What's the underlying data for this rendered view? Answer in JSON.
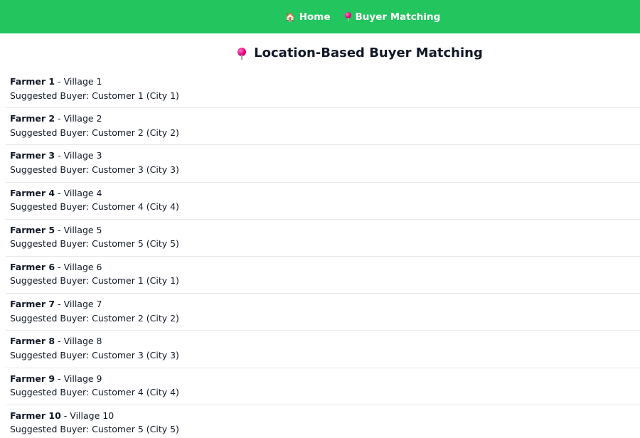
{
  "nav": {
    "home_icon": "🏠",
    "home_label": "Home",
    "buyer_icon": "round-pushpin-icon",
    "buyer_label": "Buyer Matching"
  },
  "page": {
    "title": "Location-Based Buyer Matching",
    "title_icon": "round-pushpin-icon"
  },
  "labels": {
    "separator": " - ",
    "suggested_prefix": "Suggested Buyer: "
  },
  "colors": {
    "nav_bg": "#22c55e",
    "pin": "#e4007c"
  },
  "farmers": [
    {
      "name": "Farmer 1",
      "village": "Village 1",
      "buyer": "Customer 1 (City 1)"
    },
    {
      "name": "Farmer 2",
      "village": "Village 2",
      "buyer": "Customer 2 (City 2)"
    },
    {
      "name": "Farmer 3",
      "village": "Village 3",
      "buyer": "Customer 3 (City 3)"
    },
    {
      "name": "Farmer 4",
      "village": "Village 4",
      "buyer": "Customer 4 (City 4)"
    },
    {
      "name": "Farmer 5",
      "village": "Village 5",
      "buyer": "Customer 5 (City 5)"
    },
    {
      "name": "Farmer 6",
      "village": "Village 6",
      "buyer": "Customer 1 (City 1)"
    },
    {
      "name": "Farmer 7",
      "village": "Village 7",
      "buyer": "Customer 2 (City 2)"
    },
    {
      "name": "Farmer 8",
      "village": "Village 8",
      "buyer": "Customer 3 (City 3)"
    },
    {
      "name": "Farmer 9",
      "village": "Village 9",
      "buyer": "Customer 4 (City 4)"
    },
    {
      "name": "Farmer 10",
      "village": "Village 10",
      "buyer": "Customer 5 (City 5)"
    }
  ]
}
